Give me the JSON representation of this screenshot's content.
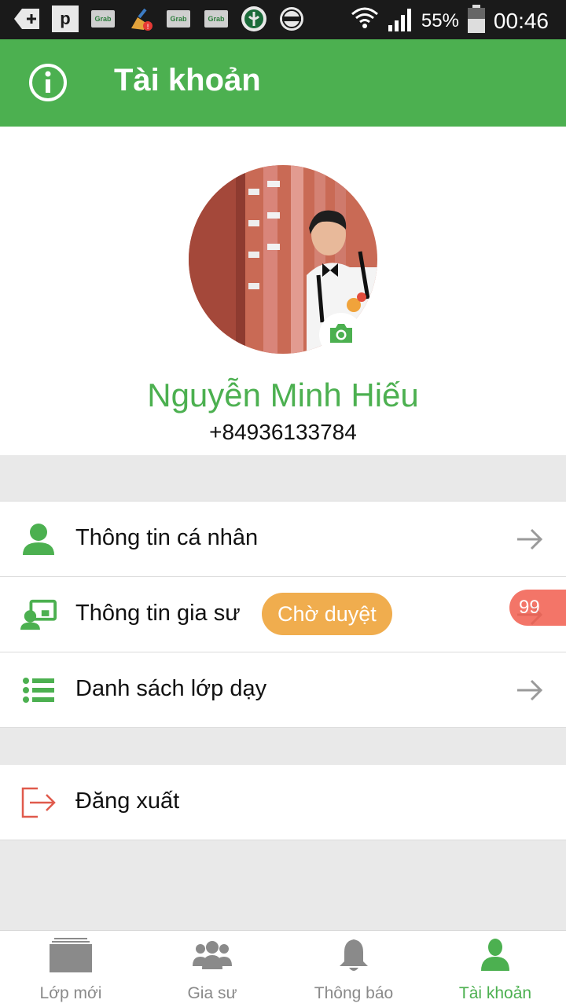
{
  "status_bar": {
    "time": "00:46",
    "battery": "55%",
    "icons": [
      "add-icon",
      "p-app-icon",
      "grab-icon",
      "cleaner-icon",
      "grab-icon",
      "grab-icon",
      "bank-icon",
      "circle-icon",
      "wifi-icon",
      "signal-icon",
      "battery-icon"
    ],
    "grab_label": "Grab"
  },
  "app_bar": {
    "title": "Tài khoản",
    "icon": "info-icon",
    "color": "#4cb050"
  },
  "profile": {
    "name": "Nguyễn Minh Hiếu",
    "phone": "+84936133784"
  },
  "menu": [
    {
      "label": "Thông tin cá nhân",
      "icon": "person-icon"
    },
    {
      "label": "Thông tin gia sư",
      "icon": "tutor-icon",
      "badge": "Chờ duyệt"
    },
    {
      "label": "Danh sách lớp dạy",
      "icon": "list-icon"
    }
  ],
  "logout": {
    "label": "Đăng xuất",
    "icon": "logout-icon"
  },
  "chat_bubble": "99",
  "colors": {
    "accent": "#4cb050",
    "badge": "#f0ad4e",
    "logout": "#e05a4c"
  },
  "bottom_nav": [
    {
      "label": "Lớp mới",
      "icon": "classes-icon"
    },
    {
      "label": "Gia sư",
      "icon": "tutors-icon"
    },
    {
      "label": "Thông báo",
      "icon": "bell-icon"
    },
    {
      "label": "Tài khoản",
      "icon": "account-icon",
      "active": true
    }
  ]
}
